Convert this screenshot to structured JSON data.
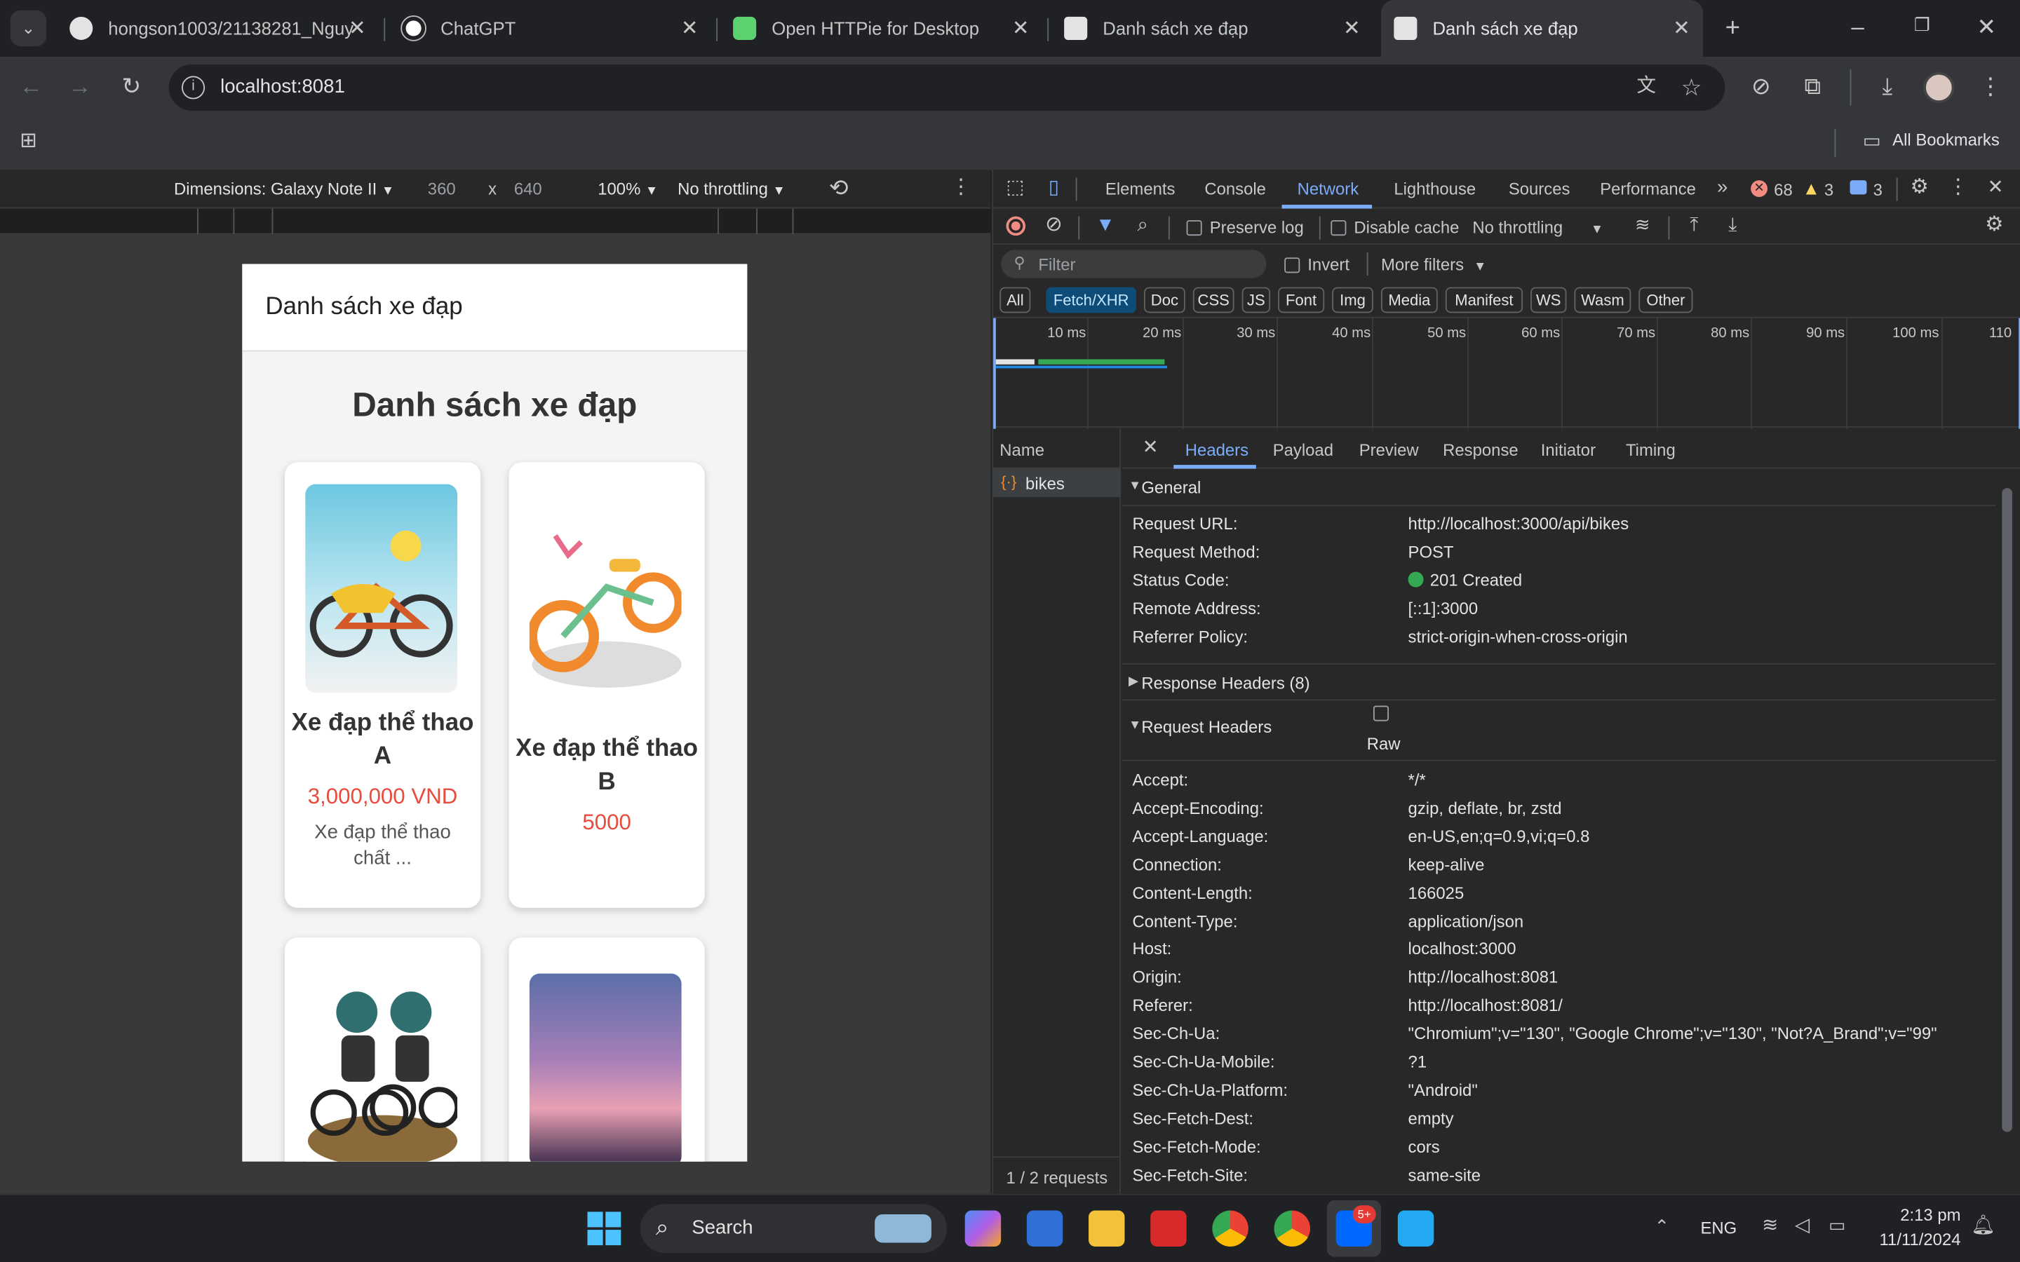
{
  "browser": {
    "tabs": [
      {
        "title": "hongson1003/21138281_Nguy",
        "icon": "github-icon"
      },
      {
        "title": "ChatGPT",
        "icon": "chatgpt-icon"
      },
      {
        "title": "Open HTTPie for Desktop",
        "icon": "httpie-icon"
      },
      {
        "title": "Danh sách xe đạp",
        "icon": "react-icon"
      },
      {
        "title": "Danh sách xe đạp",
        "icon": "react-icon",
        "active": true
      }
    ],
    "url": "localhost:8081",
    "bookmarks_label": "All Bookmarks"
  },
  "device_toolbar": {
    "dimensions_label": "Dimensions: Galaxy Note II",
    "width": "360",
    "times": "x",
    "height": "640",
    "zoom": "100%",
    "throttling": "No throttling"
  },
  "app": {
    "header_title": "Danh sách xe đạp",
    "page_title": "Danh sách xe đạp",
    "cards": [
      {
        "name": "Xe đạp thể thao A",
        "price": "3,000,000 VND",
        "description": "Xe đạp thể thao chất ..."
      },
      {
        "name": "Xe đạp thể thao B",
        "price": "5000",
        "description": ""
      },
      {
        "name": "",
        "price": "",
        "description": ""
      },
      {
        "name": "",
        "price": "",
        "description": ""
      }
    ]
  },
  "devtools": {
    "tabs": [
      "Elements",
      "Console",
      "Network",
      "Lighthouse",
      "Sources",
      "Performance"
    ],
    "active_tab": "Network",
    "errors": "68",
    "warnings": "3",
    "info": "3",
    "toolbar": {
      "preserve_log": "Preserve log",
      "disable_cache": "Disable cache",
      "throttling": "No throttling"
    },
    "filter_placeholder": "Filter",
    "invert": "Invert",
    "more_filters": "More filters",
    "type_filters": [
      "All",
      "Fetch/XHR",
      "Doc",
      "CSS",
      "JS",
      "Font",
      "Img",
      "Media",
      "Manifest",
      "WS",
      "Wasm",
      "Other"
    ],
    "active_filter": "Fetch/XHR",
    "timeline_ticks": [
      "10 ms",
      "20 ms",
      "30 ms",
      "40 ms",
      "50 ms",
      "60 ms",
      "70 ms",
      "80 ms",
      "90 ms",
      "100 ms",
      "110"
    ],
    "name_column": "Name",
    "requests": [
      "bikes"
    ],
    "requests_summary": "1 / 2 requests",
    "detail_tabs": [
      "Headers",
      "Payload",
      "Preview",
      "Response",
      "Initiator",
      "Timing"
    ],
    "active_detail_tab": "Headers",
    "general": {
      "title": "General",
      "rows": [
        {
          "k": "Request URL:",
          "v": "http://localhost:3000/api/bikes"
        },
        {
          "k": "Request Method:",
          "v": "POST"
        },
        {
          "k": "Status Code:",
          "v": "201 Created"
        },
        {
          "k": "Remote Address:",
          "v": "[::1]:3000"
        },
        {
          "k": "Referrer Policy:",
          "v": "strict-origin-when-cross-origin"
        }
      ]
    },
    "response_headers_title": "Response Headers (8)",
    "request_headers": {
      "title": "Request Headers",
      "raw_label": "Raw",
      "rows": [
        {
          "k": "Accept:",
          "v": "*/*"
        },
        {
          "k": "Accept-Encoding:",
          "v": "gzip, deflate, br, zstd"
        },
        {
          "k": "Accept-Language:",
          "v": "en-US,en;q=0.9,vi;q=0.8"
        },
        {
          "k": "Connection:",
          "v": "keep-alive"
        },
        {
          "k": "Content-Length:",
          "v": "166025"
        },
        {
          "k": "Content-Type:",
          "v": "application/json"
        },
        {
          "k": "Host:",
          "v": "localhost:3000"
        },
        {
          "k": "Origin:",
          "v": "http://localhost:8081"
        },
        {
          "k": "Referer:",
          "v": "http://localhost:8081/"
        },
        {
          "k": "Sec-Ch-Ua:",
          "v": "\"Chromium\";v=\"130\", \"Google Chrome\";v=\"130\", \"Not?A_Brand\";v=\"99\""
        },
        {
          "k": "Sec-Ch-Ua-Mobile:",
          "v": "?1"
        },
        {
          "k": "Sec-Ch-Ua-Platform:",
          "v": "\"Android\""
        },
        {
          "k": "Sec-Fetch-Dest:",
          "v": "empty"
        },
        {
          "k": "Sec-Fetch-Mode:",
          "v": "cors"
        },
        {
          "k": "Sec-Fetch-Site:",
          "v": "same-site"
        }
      ]
    }
  },
  "taskbar": {
    "search_label": "Search",
    "language": "ENG",
    "time": "2:13 pm",
    "date": "11/11/2024",
    "zalo_badge": "5+"
  },
  "colors": {
    "accent": "#7cacf8",
    "price": "#e74c3c",
    "status_ok": "#34a853",
    "error": "#f28b82",
    "warning": "#fdd663"
  }
}
